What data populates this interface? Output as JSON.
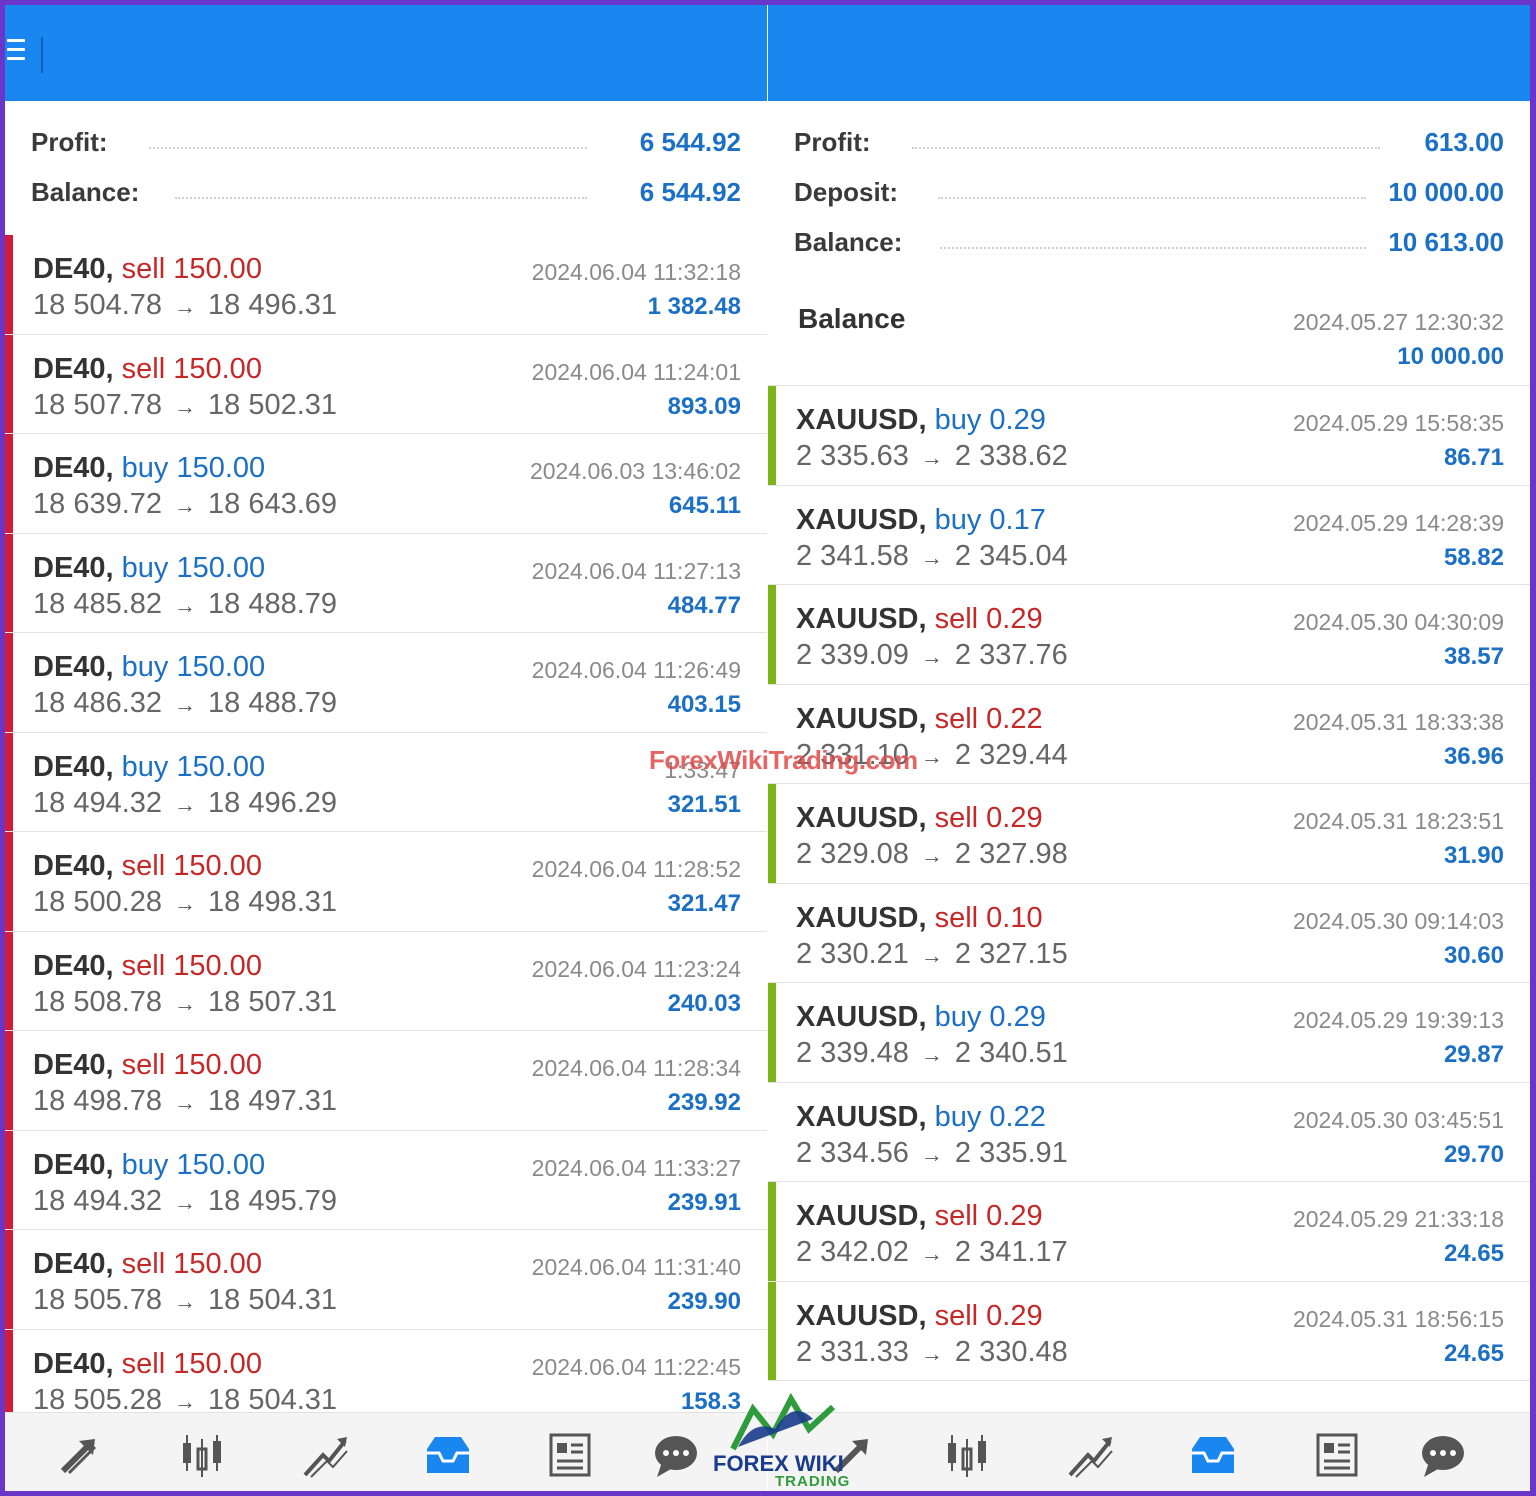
{
  "left": {
    "summary": [
      {
        "label": "Profit:",
        "value": "6 544.92"
      },
      {
        "label": "Balance:",
        "value": "6 544.92"
      }
    ],
    "trades": [
      {
        "symbol": "DE40,",
        "dir": "sell",
        "lot": "sell 150.00",
        "open": "18 504.78",
        "close": "18 496.31",
        "time": "2024.06.04 11:32:18",
        "profit": "1 382.48"
      },
      {
        "symbol": "DE40,",
        "dir": "sell",
        "lot": "sell 150.00",
        "open": "18 507.78",
        "close": "18 502.31",
        "time": "2024.06.04 11:24:01",
        "profit": "893.09"
      },
      {
        "symbol": "DE40,",
        "dir": "buy",
        "lot": "buy 150.00",
        "open": "18 639.72",
        "close": "18 643.69",
        "time": "2024.06.03 13:46:02",
        "profit": "645.11"
      },
      {
        "symbol": "DE40,",
        "dir": "buy",
        "lot": "buy 150.00",
        "open": "18 485.82",
        "close": "18 488.79",
        "time": "2024.06.04 11:27:13",
        "profit": "484.77"
      },
      {
        "symbol": "DE40,",
        "dir": "buy",
        "lot": "buy 150.00",
        "open": "18 486.32",
        "close": "18 488.79",
        "time": "2024.06.04 11:26:49",
        "profit": "403.15"
      },
      {
        "symbol": "DE40,",
        "dir": "buy",
        "lot": "buy 150.00",
        "open": "18 494.32",
        "close": "18 496.29",
        "time": "1:33:47",
        "profit": "321.51"
      },
      {
        "symbol": "DE40,",
        "dir": "sell",
        "lot": "sell 150.00",
        "open": "18 500.28",
        "close": "18 498.31",
        "time": "2024.06.04 11:28:52",
        "profit": "321.47"
      },
      {
        "symbol": "DE40,",
        "dir": "sell",
        "lot": "sell 150.00",
        "open": "18 508.78",
        "close": "18 507.31",
        "time": "2024.06.04 11:23:24",
        "profit": "240.03"
      },
      {
        "symbol": "DE40,",
        "dir": "sell",
        "lot": "sell 150.00",
        "open": "18 498.78",
        "close": "18 497.31",
        "time": "2024.06.04 11:28:34",
        "profit": "239.92"
      },
      {
        "symbol": "DE40,",
        "dir": "buy",
        "lot": "buy 150.00",
        "open": "18 494.32",
        "close": "18 495.79",
        "time": "2024.06.04 11:33:27",
        "profit": "239.91"
      },
      {
        "symbol": "DE40,",
        "dir": "sell",
        "lot": "sell 150.00",
        "open": "18 505.78",
        "close": "18 504.31",
        "time": "2024.06.04 11:31:40",
        "profit": "239.90"
      },
      {
        "symbol": "DE40,",
        "dir": "sell",
        "lot": "sell 150.00",
        "open": "18 505.28",
        "close": "18 504.31",
        "time": "2024.06.04 11:22:45",
        "profit": "158.3"
      }
    ]
  },
  "right": {
    "summary": [
      {
        "label": "Profit:",
        "value": "613.00"
      },
      {
        "label": "Deposit:",
        "value": "10 000.00"
      },
      {
        "label": "Balance:",
        "value": "10 613.00"
      }
    ],
    "balance_entry": {
      "label": "Balance",
      "time": "2024.05.27 12:30:32",
      "amount": "10 000.00"
    },
    "trades": [
      {
        "symbol": "XAUUSD,",
        "dir": "buy",
        "lot": "buy 0.29",
        "open": "2 335.63",
        "close": "2 338.62",
        "time": "2024.05.29 15:58:35",
        "profit": "86.71",
        "bar": "green"
      },
      {
        "symbol": "XAUUSD,",
        "dir": "buy",
        "lot": "buy 0.17",
        "open": "2 341.58",
        "close": "2 345.04",
        "time": "2024.05.29 14:28:39",
        "profit": "58.82",
        "bar": "none"
      },
      {
        "symbol": "XAUUSD,",
        "dir": "sell",
        "lot": "sell 0.29",
        "open": "2 339.09",
        "close": "2 337.76",
        "time": "2024.05.30 04:30:09",
        "profit": "38.57",
        "bar": "green"
      },
      {
        "symbol": "XAUUSD,",
        "dir": "sell",
        "lot": "sell 0.22",
        "open": "2 331.10",
        "close": "2 329.44",
        "time": "2024.05.31 18:33:38",
        "profit": "36.96",
        "bar": "none"
      },
      {
        "symbol": "XAUUSD,",
        "dir": "sell",
        "lot": "sell 0.29",
        "open": "2 329.08",
        "close": "2 327.98",
        "time": "2024.05.31 18:23:51",
        "profit": "31.90",
        "bar": "green"
      },
      {
        "symbol": "XAUUSD,",
        "dir": "sell",
        "lot": "sell 0.10",
        "open": "2 330.21",
        "close": "2 327.15",
        "time": "2024.05.30 09:14:03",
        "profit": "30.60",
        "bar": "none"
      },
      {
        "symbol": "XAUUSD,",
        "dir": "buy",
        "lot": "buy 0.29",
        "open": "2 339.48",
        "close": "2 340.51",
        "time": "2024.05.29 19:39:13",
        "profit": "29.87",
        "bar": "green"
      },
      {
        "symbol": "XAUUSD,",
        "dir": "buy",
        "lot": "buy 0.22",
        "open": "2 334.56",
        "close": "2 335.91",
        "time": "2024.05.30 03:45:51",
        "profit": "29.70",
        "bar": "none"
      },
      {
        "symbol": "XAUUSD,",
        "dir": "sell",
        "lot": "sell 0.29",
        "open": "2 342.02",
        "close": "2 341.17",
        "time": "2024.05.29 21:33:18",
        "profit": "24.65",
        "bar": "green"
      },
      {
        "symbol": "XAUUSD,",
        "dir": "sell",
        "lot": "sell 0.29",
        "open": "2 331.33",
        "close": "2 330.48",
        "time": "2024.05.31 18:56:15",
        "profit": "24.65",
        "bar": "green"
      }
    ]
  },
  "arrow_glyph": "→",
  "watermark": "ForexWikiTrading.com",
  "logo": {
    "name": "FOREX WIKI",
    "sub": "TRADING"
  },
  "nav_icons": [
    "trade-icon",
    "quotes-icon",
    "chart-icon",
    "history-icon",
    "news-icon",
    "chat-icon"
  ],
  "colors": {
    "topbar": "#1a86f0",
    "sell": "#c62828",
    "buy": "#1b6fc4",
    "loss_bar": "#d21c3a",
    "win_bar": "#7cb518",
    "border": "#6a35c9"
  }
}
